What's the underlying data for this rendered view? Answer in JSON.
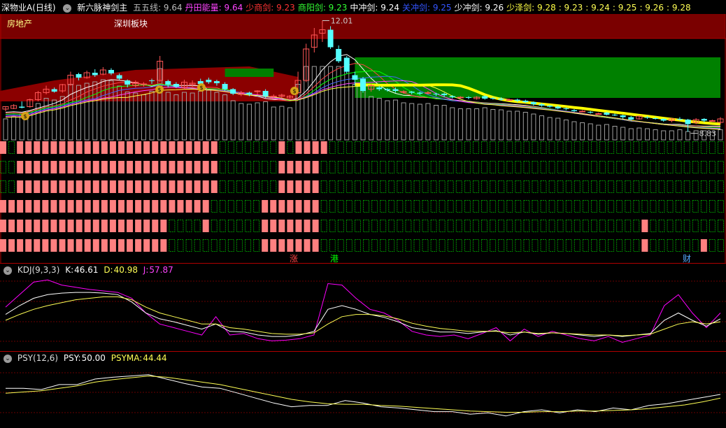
{
  "header": {
    "symbol": "深物业A(日线)",
    "indicator_name": "新六脉神剑主",
    "items": [
      {
        "label": "五五线",
        "value": "9.64",
        "color": "#bbbbbb"
      },
      {
        "label": "丹田能量",
        "value": "9.64",
        "color": "#ff44ff"
      },
      {
        "label": "少商剑",
        "value": "9.23",
        "color": "#ff3333"
      },
      {
        "label": "商阳剑",
        "value": "9.23",
        "color": "#33ff33"
      },
      {
        "label": "中冲剑",
        "value": "9.24",
        "color": "#ffffff"
      },
      {
        "label": "关冲剑",
        "value": "9.25",
        "color": "#3355ff"
      },
      {
        "label": "少冲剑",
        "value": "9.26",
        "color": "#ffffff"
      },
      {
        "label": "少泽剑",
        "value": "9.28",
        "color": "#ffff44"
      }
    ],
    "extra_values": [
      "9.23",
      "9.24",
      "9.25",
      "9.26",
      "9.28"
    ]
  },
  "main_panel": {
    "sector_label": "房地产",
    "board_label": "深圳板块",
    "high_marker": "12.01",
    "low_marker": "8.83"
  },
  "markers": {
    "zhang": "涨",
    "gang": "港",
    "cai": "财"
  },
  "kdj": {
    "name": "KDJ(9,3,3)",
    "k_label": "K:",
    "k": "46.61",
    "d_label": "D:",
    "d": "40.98",
    "j_label": "J:",
    "j": "57.87"
  },
  "psy": {
    "name": "PSY(12,6)",
    "psy_label": "PSY:",
    "psy": "50.00",
    "psyma_label": "PSYMA:",
    "psyma": "44.44"
  },
  "colors": {
    "up": "#ff5555",
    "down": "#55ffff",
    "signal_red": "#ff8080",
    "signal_green": "#009000",
    "yellow": "#ffff00",
    "magenta": "#ff00ff"
  },
  "chart_data": {
    "type": "candlestick",
    "candles": [
      [
        9.48,
        9.55,
        9.42,
        9.56
      ],
      [
        9.5,
        9.58,
        9.48,
        9.62
      ],
      [
        9.55,
        9.52,
        9.5,
        9.7
      ],
      [
        9.55,
        9.75,
        9.52,
        9.78
      ],
      [
        9.75,
        9.95,
        9.7,
        10.0
      ],
      [
        9.95,
        10.05,
        9.9,
        10.15
      ],
      [
        10.05,
        9.98,
        9.95,
        10.1
      ],
      [
        10.0,
        10.18,
        9.95,
        10.2
      ],
      [
        10.18,
        10.45,
        10.15,
        10.55
      ],
      [
        10.48,
        10.38,
        10.3,
        10.52
      ],
      [
        10.38,
        10.52,
        10.35,
        10.58
      ],
      [
        10.52,
        10.45,
        10.4,
        10.62
      ],
      [
        10.48,
        10.6,
        10.45,
        10.68
      ],
      [
        10.6,
        10.5,
        10.45,
        10.65
      ],
      [
        10.45,
        10.35,
        10.3,
        10.5
      ],
      [
        10.3,
        10.18,
        10.1,
        10.33
      ],
      [
        10.15,
        10.25,
        10.1,
        10.3
      ],
      [
        10.2,
        10.2,
        10.12,
        10.25
      ],
      [
        10.3,
        10.28,
        10.2,
        10.35
      ],
      [
        10.3,
        10.85,
        10.25,
        11.0
      ],
      [
        10.28,
        10.18,
        10.1,
        10.32
      ],
      [
        10.2,
        10.12,
        10.08,
        10.25
      ],
      [
        10.1,
        10.25,
        10.05,
        10.32
      ],
      [
        10.18,
        10.22,
        10.12,
        10.3
      ],
      [
        10.28,
        10.2,
        10.15,
        10.35
      ],
      [
        10.32,
        10.25,
        10.2,
        10.38
      ],
      [
        10.28,
        10.22,
        10.15,
        10.32
      ],
      [
        10.2,
        10.05,
        10.0,
        10.25
      ],
      [
        10.05,
        9.92,
        9.88,
        10.08
      ],
      [
        9.9,
        9.95,
        9.85,
        10.0
      ],
      [
        9.95,
        9.9,
        9.85,
        9.98
      ],
      [
        9.98,
        10.0,
        9.9,
        10.02
      ],
      [
        10.0,
        9.85,
        9.8,
        10.05
      ],
      [
        9.85,
        9.85,
        9.8,
        9.9
      ],
      [
        9.85,
        9.88,
        9.8,
        9.92
      ],
      [
        9.8,
        9.85,
        9.78,
        9.88
      ],
      [
        9.95,
        10.3,
        9.9,
        10.55
      ],
      [
        10.3,
        11.2,
        10.25,
        11.35
      ],
      [
        11.25,
        11.6,
        11.1,
        11.8
      ],
      [
        11.65,
        11.75,
        11.4,
        12.01
      ],
      [
        11.75,
        11.25,
        11.2,
        11.85
      ],
      [
        11.2,
        10.85,
        10.8,
        11.3
      ],
      [
        10.95,
        10.55,
        10.5,
        11.0
      ],
      [
        10.45,
        10.32,
        10.15,
        10.55
      ],
      [
        10.35,
        10.0,
        9.95,
        10.4
      ],
      [
        10.05,
        10.15,
        9.98,
        10.2
      ],
      [
        10.1,
        10.05,
        10.0,
        10.15
      ],
      [
        10.05,
        10.02,
        9.98,
        10.08
      ],
      [
        10.05,
        10.0,
        9.95,
        10.1
      ],
      [
        9.98,
        9.98,
        9.92,
        10.02
      ],
      [
        9.98,
        9.95,
        9.9,
        10.0
      ],
      [
        9.95,
        9.92,
        9.88,
        9.98
      ],
      [
        9.95,
        9.95,
        9.9,
        10.0
      ],
      [
        9.92,
        9.9,
        9.85,
        9.95
      ],
      [
        9.92,
        9.88,
        9.82,
        9.95
      ],
      [
        9.85,
        9.82,
        9.78,
        9.88
      ],
      [
        9.82,
        9.82,
        9.78,
        9.85
      ],
      [
        9.82,
        9.8,
        9.76,
        9.85
      ],
      [
        9.78,
        9.82,
        9.75,
        9.85
      ],
      [
        9.85,
        9.78,
        9.75,
        9.88
      ],
      [
        9.8,
        9.78,
        9.75,
        9.83
      ],
      [
        9.78,
        9.75,
        9.72,
        9.82
      ],
      [
        9.75,
        9.75,
        9.72,
        9.78
      ],
      [
        9.75,
        9.72,
        9.68,
        9.78
      ],
      [
        9.72,
        9.68,
        9.65,
        9.75
      ],
      [
        9.68,
        9.62,
        9.58,
        9.7
      ],
      [
        9.62,
        9.58,
        9.55,
        9.65
      ],
      [
        9.58,
        9.55,
        9.52,
        9.6
      ],
      [
        9.55,
        9.5,
        9.48,
        9.58
      ],
      [
        9.5,
        9.48,
        9.45,
        9.53
      ],
      [
        9.45,
        9.42,
        9.4,
        9.48
      ],
      [
        9.42,
        9.42,
        9.4,
        9.45
      ],
      [
        9.4,
        9.38,
        9.35,
        9.42
      ],
      [
        9.35,
        9.35,
        9.32,
        9.38
      ],
      [
        9.38,
        9.32,
        9.3,
        9.4
      ],
      [
        9.32,
        9.3,
        9.28,
        9.35
      ],
      [
        9.3,
        9.25,
        9.2,
        9.32
      ],
      [
        9.25,
        9.18,
        9.15,
        9.28
      ],
      [
        9.2,
        9.28,
        9.18,
        9.3
      ],
      [
        9.25,
        9.23,
        9.2,
        9.28
      ],
      [
        9.22,
        9.2,
        9.18,
        9.25
      ],
      [
        9.2,
        9.15,
        9.12,
        9.22
      ],
      [
        9.15,
        9.2,
        9.1,
        9.22
      ],
      [
        9.2,
        9.18,
        9.15,
        9.25
      ],
      [
        9.18,
        9.05,
        8.83,
        9.2
      ],
      [
        9.1,
        9.18,
        9.05,
        9.22
      ],
      [
        9.2,
        9.15,
        9.1,
        9.22
      ],
      [
        9.15,
        9.15,
        9.12,
        9.18
      ],
      [
        9.1,
        9.2,
        9.05,
        9.25
      ]
    ]
  }
}
